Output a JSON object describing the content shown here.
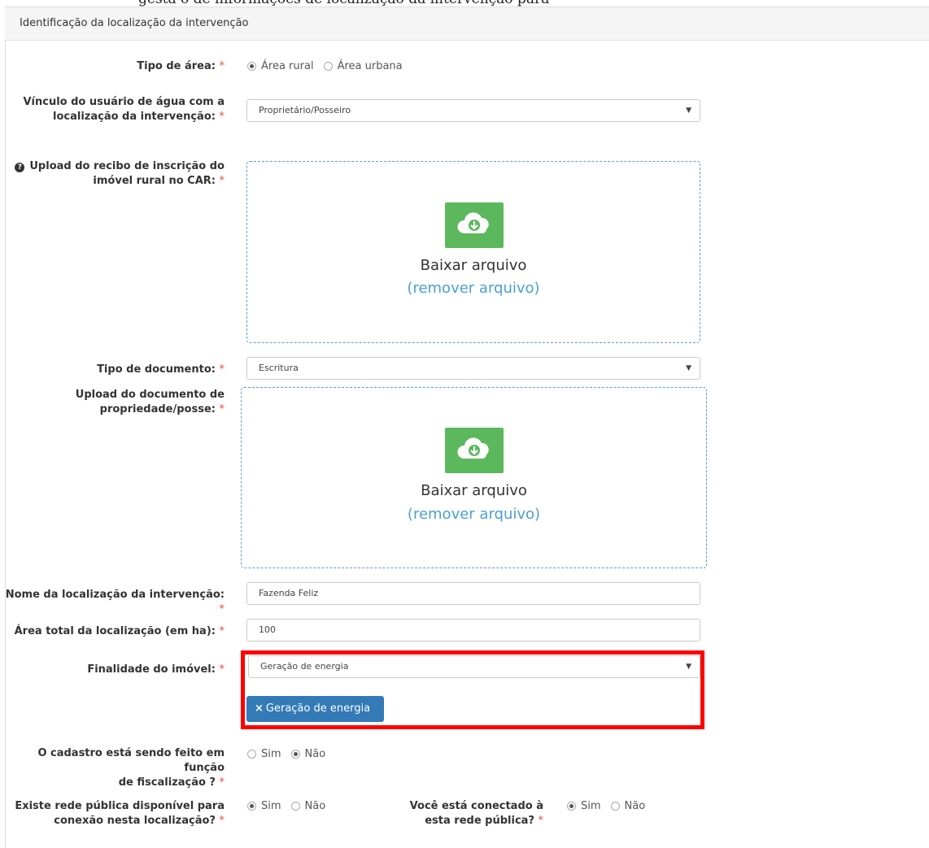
{
  "page_header_fragment": "gesta o de informações de localização da intervenção para",
  "panel": {
    "title": "Identificação da localização da intervenção"
  },
  "fields": {
    "tipo_area": {
      "label": "Tipo de área:",
      "required": "*",
      "options": [
        "Área rural",
        "Área urbana"
      ],
      "selected": "Área rural"
    },
    "vinculo": {
      "label_line1": "Vínculo do usuário de água com a",
      "label_line2": "localização da intervenção:",
      "required": "*",
      "value": "Proprietário/Posseiro"
    },
    "upload_car": {
      "label_line1": "Upload do recibo de inscrição do",
      "label_line2": "imóvel rural no CAR:",
      "required": "*",
      "download_text": "Baixar arquivo",
      "remove_text": "(remover arquivo)"
    },
    "tipo_documento": {
      "label": "Tipo de documento:",
      "required": "*",
      "value": "Escritura"
    },
    "upload_propriedade": {
      "label_line1": "Upload do documento de",
      "label_line2": "propriedade/posse:",
      "required": "*",
      "download_text": "Baixar arquivo",
      "remove_text": "(remover arquivo)"
    },
    "nome_localizacao": {
      "label": "Nome da localização da intervenção:",
      "required": "*",
      "value": "Fazenda Feliz"
    },
    "area_total": {
      "label": "Área total da localização (em ha):",
      "required": "*",
      "value": "100"
    },
    "finalidade": {
      "label": "Finalidade do imóvel:",
      "required": "*",
      "value": "Geração de energia",
      "tag": "Geração de energia",
      "tag_icon": "×"
    },
    "fiscalizacao": {
      "label_line1": "O cadastro está sendo feito em função",
      "label_line2": "de fiscalização ?",
      "required": "*",
      "options": [
        "Sim",
        "Não"
      ],
      "selected": "Não"
    },
    "rede_publica": {
      "label_line1": "Existe rede pública disponível para",
      "label_line2": "conexão nesta localização?",
      "required": "*",
      "options": [
        "Sim",
        "Não"
      ],
      "selected": "Sim"
    },
    "conectado": {
      "label_line1": "Você está conectado à",
      "label_line2": "esta rede pública?",
      "required": "*",
      "options": [
        "Sim",
        "Não"
      ],
      "selected": "Sim"
    }
  },
  "colors": {
    "required": "#e74c3c",
    "upload_icon_bg": "#5cb85c",
    "link": "#4a9fd5",
    "tag_bg": "#337ab7",
    "highlight": "#ff0000"
  },
  "icons": {
    "upload": "cloud-download-icon",
    "caret": "caret-down-icon",
    "help": "question-circle-icon"
  }
}
